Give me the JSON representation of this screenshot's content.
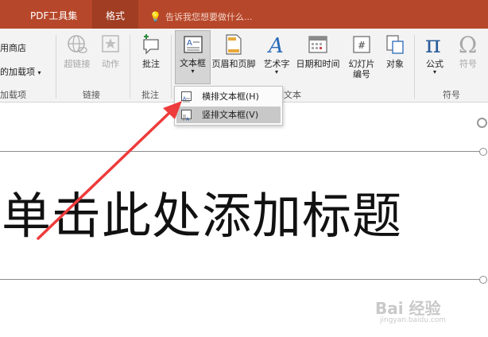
{
  "tabs": [
    {
      "label": "PDF工具集"
    },
    {
      "label": "格式"
    }
  ],
  "tell_me": "告诉我您想要做什么...",
  "ribbon": {
    "left_items": [
      "用商店",
      "的加载项"
    ],
    "addins_group": "加载项",
    "links": {
      "hyperlink": "超链接",
      "action": "动作",
      "group": "链接"
    },
    "comments": {
      "comment": "批注",
      "group": "批注"
    },
    "text": {
      "textbox": "文本框",
      "header_footer": "页眉和页脚",
      "wordart": "艺术字",
      "datetime": "日期和时间",
      "slide_num_line1": "幻灯片",
      "slide_num_line2": "编号",
      "object": "对象",
      "group": "文本"
    },
    "symbols": {
      "equation": "公式",
      "symbol": "符号",
      "group": "符号"
    }
  },
  "dropdown": {
    "items": [
      {
        "label": "横排文本框(H)"
      },
      {
        "label": "竖排文本框(V)"
      }
    ]
  },
  "slide": {
    "title_placeholder": "单击此处添加标题"
  },
  "watermark": {
    "logo": "Bai 经验",
    "url": "jingyan.baidu.com"
  },
  "colors": {
    "accent": "#b7472a",
    "arrow": "#ee3b3b"
  }
}
